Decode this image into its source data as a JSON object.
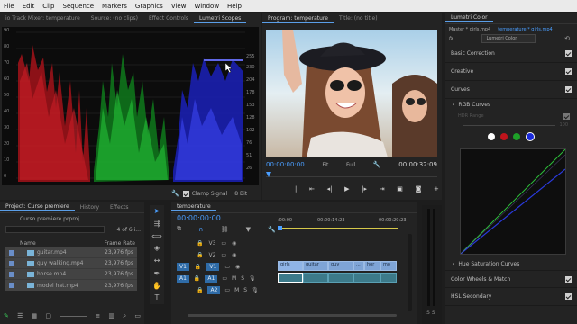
{
  "menu": [
    "File",
    "Edit",
    "Clip",
    "Sequence",
    "Markers",
    "Graphics",
    "View",
    "Window",
    "Help"
  ],
  "scopes": {
    "tabs": [
      "io Track Mixer: temperature",
      "Source: (no clips)",
      "Effect Controls",
      "Lumetri Scopes"
    ],
    "left_scale": [
      "90",
      "80",
      "70",
      "60",
      "50",
      "40",
      "30",
      "20",
      "10",
      "0"
    ],
    "right_scale": [
      "255",
      "230",
      "204",
      "178",
      "153",
      "128",
      "102",
      "76",
      "51",
      "26"
    ],
    "clamp_label": "Clamp Signal",
    "bit_depth": "8 Bit"
  },
  "program": {
    "tabs": [
      "Program: temperature",
      "Title: (no title)"
    ],
    "timecode_current": "00:00:00:00",
    "fit": "Fit",
    "quality": "Full",
    "timecode_duration": "00:00:32:09"
  },
  "lumetri": {
    "title": "Lumetri Color",
    "master_clip": "Master * girls.mp4",
    "sequence_clip": "temperature * girls.mp4",
    "fx_label": "fx",
    "effect_name": "Lumetri Color",
    "sections": [
      "Basic Correction",
      "Creative",
      "Curves"
    ],
    "rgb_curves": "RGB Curves",
    "hdr_range": "HDR Range",
    "hdr_value": "100",
    "hue_sat": "Hue Saturation Curves",
    "color_wheels": "Color Wheels & Match",
    "hsl": "HSL Secondary"
  },
  "project": {
    "tabs": [
      "Project: Curso premiere",
      "History",
      "Effects"
    ],
    "file": "Curso premiere.prproj",
    "count": "4 of 6 i...",
    "col_name": "Name",
    "col_rate": "Frame Rate",
    "items": [
      {
        "name": "guitar.mp4",
        "rate": "23,976 fps"
      },
      {
        "name": "guy walking.mp4",
        "rate": "23,976 fps"
      },
      {
        "name": "horse.mp4",
        "rate": "23,976 fps"
      },
      {
        "name": "model hat.mp4",
        "rate": "23,976 fps"
      }
    ]
  },
  "timeline": {
    "tab": "temperature",
    "timecode": "00:00:00:00",
    "ruler": [
      ":00:00",
      "00:00:14:23",
      "00:00:29:23"
    ],
    "video_tracks": [
      "V3",
      "V2",
      "V1"
    ],
    "audio_tracks": [
      "A1",
      "A2"
    ],
    "track_src_v": "V1",
    "track_src_a": "A1",
    "clips": [
      "girls",
      "guitar",
      "guy",
      "...",
      "hor",
      "mo"
    ]
  },
  "colors": {
    "accent": "#4a9eff",
    "menubar": "#eaeaea",
    "panel": "#232323"
  }
}
